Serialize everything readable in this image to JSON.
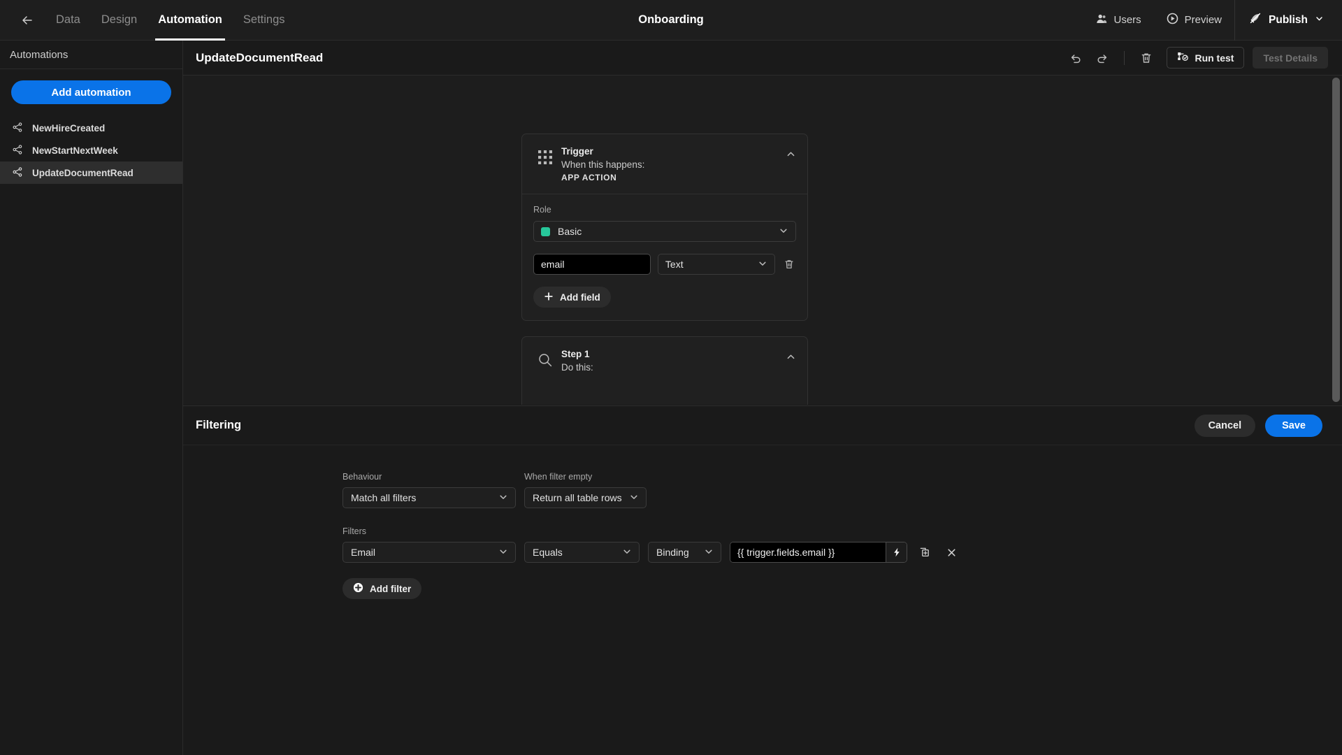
{
  "topnav": {
    "back_icon": "arrow-left-icon",
    "tabs": [
      {
        "label": "Data",
        "active": false
      },
      {
        "label": "Design",
        "active": false
      },
      {
        "label": "Automation",
        "active": true
      },
      {
        "label": "Settings",
        "active": false
      }
    ],
    "app_title": "Onboarding",
    "users_label": "Users",
    "preview_label": "Preview",
    "publish_label": "Publish"
  },
  "sidebar": {
    "header": "Automations",
    "add_button": "Add automation",
    "items": [
      {
        "label": "NewHireCreated",
        "selected": false
      },
      {
        "label": "NewStartNextWeek",
        "selected": false
      },
      {
        "label": "UpdateDocumentRead",
        "selected": true
      }
    ]
  },
  "main": {
    "flow_title": "UpdateDocumentRead",
    "run_test_label": "Run test",
    "test_details_label": "Test Details"
  },
  "flow": {
    "trigger": {
      "name": "Trigger",
      "subtitle": "When this happens:",
      "type": "APP ACTION",
      "role_label": "Role",
      "role_value": "Basic",
      "role_swatch_color": "#27c79a",
      "field_name": "email",
      "field_type": "Text",
      "add_field_label": "Add field"
    },
    "step1": {
      "name": "Step 1",
      "subtitle": "Do this:"
    }
  },
  "drawer": {
    "title": "Filtering",
    "cancel_label": "Cancel",
    "save_label": "Save",
    "behaviour_label": "Behaviour",
    "behaviour_value": "Match all filters",
    "when_empty_label": "When filter empty",
    "when_empty_value": "Return all table rows",
    "filters_label": "Filters",
    "filter_field": "Email",
    "filter_operator": "Equals",
    "filter_value_type": "Binding",
    "filter_value": "{{ trigger.fields.email }}",
    "add_filter_label": "Add filter"
  },
  "colors": {
    "accent": "#0a73e8",
    "bg": "#1a1a1a",
    "panel": "#1d1d1d",
    "card": "#202020",
    "role_swatch": "#27c79a"
  }
}
